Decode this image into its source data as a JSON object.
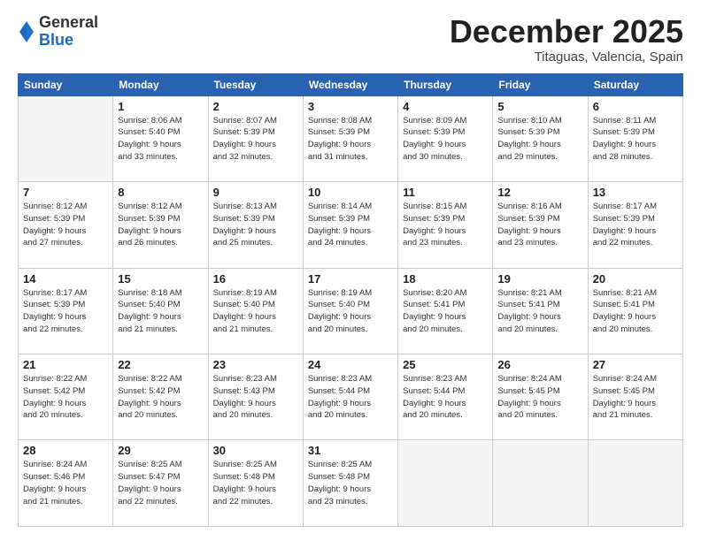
{
  "header": {
    "logo_general": "General",
    "logo_blue": "Blue",
    "month_title": "December 2025",
    "location": "Titaguas, Valencia, Spain"
  },
  "weekdays": [
    "Sunday",
    "Monday",
    "Tuesday",
    "Wednesday",
    "Thursday",
    "Friday",
    "Saturday"
  ],
  "weeks": [
    [
      {
        "day": "",
        "info": ""
      },
      {
        "day": "1",
        "info": "Sunrise: 8:06 AM\nSunset: 5:40 PM\nDaylight: 9 hours\nand 33 minutes."
      },
      {
        "day": "2",
        "info": "Sunrise: 8:07 AM\nSunset: 5:39 PM\nDaylight: 9 hours\nand 32 minutes."
      },
      {
        "day": "3",
        "info": "Sunrise: 8:08 AM\nSunset: 5:39 PM\nDaylight: 9 hours\nand 31 minutes."
      },
      {
        "day": "4",
        "info": "Sunrise: 8:09 AM\nSunset: 5:39 PM\nDaylight: 9 hours\nand 30 minutes."
      },
      {
        "day": "5",
        "info": "Sunrise: 8:10 AM\nSunset: 5:39 PM\nDaylight: 9 hours\nand 29 minutes."
      },
      {
        "day": "6",
        "info": "Sunrise: 8:11 AM\nSunset: 5:39 PM\nDaylight: 9 hours\nand 28 minutes."
      }
    ],
    [
      {
        "day": "7",
        "info": "Sunrise: 8:12 AM\nSunset: 5:39 PM\nDaylight: 9 hours\nand 27 minutes."
      },
      {
        "day": "8",
        "info": "Sunrise: 8:12 AM\nSunset: 5:39 PM\nDaylight: 9 hours\nand 26 minutes."
      },
      {
        "day": "9",
        "info": "Sunrise: 8:13 AM\nSunset: 5:39 PM\nDaylight: 9 hours\nand 25 minutes."
      },
      {
        "day": "10",
        "info": "Sunrise: 8:14 AM\nSunset: 5:39 PM\nDaylight: 9 hours\nand 24 minutes."
      },
      {
        "day": "11",
        "info": "Sunrise: 8:15 AM\nSunset: 5:39 PM\nDaylight: 9 hours\nand 23 minutes."
      },
      {
        "day": "12",
        "info": "Sunrise: 8:16 AM\nSunset: 5:39 PM\nDaylight: 9 hours\nand 23 minutes."
      },
      {
        "day": "13",
        "info": "Sunrise: 8:17 AM\nSunset: 5:39 PM\nDaylight: 9 hours\nand 22 minutes."
      }
    ],
    [
      {
        "day": "14",
        "info": "Sunrise: 8:17 AM\nSunset: 5:39 PM\nDaylight: 9 hours\nand 22 minutes."
      },
      {
        "day": "15",
        "info": "Sunrise: 8:18 AM\nSunset: 5:40 PM\nDaylight: 9 hours\nand 21 minutes."
      },
      {
        "day": "16",
        "info": "Sunrise: 8:19 AM\nSunset: 5:40 PM\nDaylight: 9 hours\nand 21 minutes."
      },
      {
        "day": "17",
        "info": "Sunrise: 8:19 AM\nSunset: 5:40 PM\nDaylight: 9 hours\nand 20 minutes."
      },
      {
        "day": "18",
        "info": "Sunrise: 8:20 AM\nSunset: 5:41 PM\nDaylight: 9 hours\nand 20 minutes."
      },
      {
        "day": "19",
        "info": "Sunrise: 8:21 AM\nSunset: 5:41 PM\nDaylight: 9 hours\nand 20 minutes."
      },
      {
        "day": "20",
        "info": "Sunrise: 8:21 AM\nSunset: 5:41 PM\nDaylight: 9 hours\nand 20 minutes."
      }
    ],
    [
      {
        "day": "21",
        "info": "Sunrise: 8:22 AM\nSunset: 5:42 PM\nDaylight: 9 hours\nand 20 minutes."
      },
      {
        "day": "22",
        "info": "Sunrise: 8:22 AM\nSunset: 5:42 PM\nDaylight: 9 hours\nand 20 minutes."
      },
      {
        "day": "23",
        "info": "Sunrise: 8:23 AM\nSunset: 5:43 PM\nDaylight: 9 hours\nand 20 minutes."
      },
      {
        "day": "24",
        "info": "Sunrise: 8:23 AM\nSunset: 5:44 PM\nDaylight: 9 hours\nand 20 minutes."
      },
      {
        "day": "25",
        "info": "Sunrise: 8:23 AM\nSunset: 5:44 PM\nDaylight: 9 hours\nand 20 minutes."
      },
      {
        "day": "26",
        "info": "Sunrise: 8:24 AM\nSunset: 5:45 PM\nDaylight: 9 hours\nand 20 minutes."
      },
      {
        "day": "27",
        "info": "Sunrise: 8:24 AM\nSunset: 5:45 PM\nDaylight: 9 hours\nand 21 minutes."
      }
    ],
    [
      {
        "day": "28",
        "info": "Sunrise: 8:24 AM\nSunset: 5:46 PM\nDaylight: 9 hours\nand 21 minutes."
      },
      {
        "day": "29",
        "info": "Sunrise: 8:25 AM\nSunset: 5:47 PM\nDaylight: 9 hours\nand 22 minutes."
      },
      {
        "day": "30",
        "info": "Sunrise: 8:25 AM\nSunset: 5:48 PM\nDaylight: 9 hours\nand 22 minutes."
      },
      {
        "day": "31",
        "info": "Sunrise: 8:25 AM\nSunset: 5:48 PM\nDaylight: 9 hours\nand 23 minutes."
      },
      {
        "day": "",
        "info": ""
      },
      {
        "day": "",
        "info": ""
      },
      {
        "day": "",
        "info": ""
      }
    ]
  ]
}
